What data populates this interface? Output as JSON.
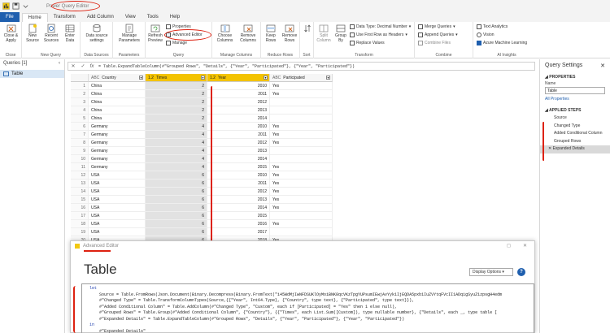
{
  "window": {
    "title": "Power Query Editor"
  },
  "tabs": [
    "File",
    "Home",
    "Transform",
    "Add Column",
    "View",
    "Tools",
    "Help"
  ],
  "ribbon": {
    "close": {
      "close_apply": "Close &\nApply",
      "group": "Close"
    },
    "new_query": {
      "new_source": "New\nSource",
      "recent_sources": "Recent\nSources",
      "enter_data": "Enter\nData",
      "group": "New Query"
    },
    "data_sources": {
      "settings": "Data source\nsettings",
      "group": "Data Sources"
    },
    "parameters": {
      "manage": "Manage\nParameters",
      "group": "Parameters"
    },
    "query": {
      "refresh": "Refresh\nPreview",
      "properties": "Properties",
      "advanced_editor": "Advanced Editor",
      "manage": "Manage",
      "group": "Query"
    },
    "manage_columns": {
      "choose": "Choose\nColumns",
      "remove": "Remove\nColumns",
      "group": "Manage Columns"
    },
    "reduce_rows": {
      "keep": "Keep\nRows",
      "remove": "Remove\nRows",
      "group": "Reduce Rows"
    },
    "sort": {
      "group": "Sort"
    },
    "transform": {
      "split": "Split\nColumn",
      "group_by": "Group\nBy",
      "data_type": "Data Type: Decimal Number",
      "first_row": "Use First Row as Headers",
      "replace": "Replace Values",
      "group": "Transform"
    },
    "combine": {
      "merge": "Merge Queries",
      "append": "Append Queries",
      "combine_files": "Combine Files",
      "group": "Combine"
    },
    "ai": {
      "text_analytics": "Text Analytics",
      "vision": "Vision",
      "azure_ml": "Azure Machine Learning",
      "group": "AI Insights"
    }
  },
  "queries_pane": {
    "header": "Queries [1]",
    "items": [
      "Table"
    ]
  },
  "formula_bar": {
    "fx": "fx",
    "text": "= Table.ExpandTableColumn(#\"Grouped Rows\", \"Details\", {\"Year\", \"Participated\"}, {\"Year\", \"Participated\"})"
  },
  "grid": {
    "columns": [
      {
        "type": "ABC",
        "name": "Country"
      },
      {
        "type": "1.2",
        "name": "Times"
      },
      {
        "type": "1.2",
        "name": "Year"
      },
      {
        "type": "ABC",
        "name": "Participated"
      }
    ],
    "rows": [
      [
        "1",
        "China",
        "2",
        "2010",
        "Yes"
      ],
      [
        "2",
        "China",
        "2",
        "2011",
        "Yes"
      ],
      [
        "3",
        "China",
        "2",
        "2012",
        ""
      ],
      [
        "4",
        "China",
        "2",
        "2013",
        ""
      ],
      [
        "5",
        "China",
        "2",
        "2014",
        ""
      ],
      [
        "6",
        "Germany",
        "4",
        "2010",
        "Yes"
      ],
      [
        "7",
        "Germany",
        "4",
        "2011",
        "Yes"
      ],
      [
        "8",
        "Germany",
        "4",
        "2012",
        "Yes"
      ],
      [
        "9",
        "Germany",
        "4",
        "2013",
        ""
      ],
      [
        "10",
        "Germany",
        "4",
        "2014",
        ""
      ],
      [
        "11",
        "Germany",
        "4",
        "2015",
        "Yes"
      ],
      [
        "12",
        "USA",
        "6",
        "2010",
        "Yes"
      ],
      [
        "13",
        "USA",
        "6",
        "2011",
        "Yes"
      ],
      [
        "14",
        "USA",
        "6",
        "2012",
        "Yes"
      ],
      [
        "15",
        "USA",
        "6",
        "2013",
        "Yes"
      ],
      [
        "16",
        "USA",
        "6",
        "2014",
        "Yes"
      ],
      [
        "17",
        "USA",
        "6",
        "2015",
        ""
      ],
      [
        "18",
        "USA",
        "6",
        "2016",
        "Yes"
      ],
      [
        "19",
        "USA",
        "6",
        "2017",
        ""
      ],
      [
        "20",
        "USA",
        "6",
        "2018",
        "Yes"
      ]
    ]
  },
  "query_settings": {
    "title": "Query Settings",
    "properties_label": "PROPERTIES",
    "name_label": "Name",
    "name_value": "Table",
    "all_properties": "All Properties",
    "applied_steps_label": "APPLIED STEPS",
    "steps": [
      "Source",
      "Changed Type",
      "Added Conditional Column",
      "Grouped Rows",
      "Expanded Details"
    ],
    "selected_step": 4
  },
  "advanced_editor": {
    "title": "Advanced Editor",
    "heading": "Table",
    "display_options": "Display Options",
    "help": "?",
    "code": [
      "let",
      "    Source = Table.FromRows(Json.Document(Binary.Decompress(Binary.FromText(\"i45WdMjIwNFDSUKlOyMoiBNK8qcVKzTpgYUPsumIEwjAvYyk1IjEQDA5pxb1IuZVYtqFVcII1ADqigSyuZ1zpsgH4edm",
      "    #\"Changed Type\" = Table.TransformColumnTypes(Source,{{\"Year\", Int64.Type}, {\"Country\", type text}, {\"Participated\", type text}}),",
      "    #\"Added Conditional Column\" = Table.AddColumn(#\"Changed Type\", \"Custom\", each if [Participated] = \"Yes\" then 1 else null),",
      "    #\"Grouped Rows\" = Table.Group(#\"Added Conditional Column\", {\"Country\"}, {{\"Times\", each List.Sum([Custom]), type nullable number}, {\"Details\", each _, type table [",
      "    #\"Expanded Details\" = Table.ExpandTableColumn(#\"Grouped Rows\", \"Details\", {\"Year\", \"Participated\"}, {\"Year\", \"Participated\"})",
      "in",
      "    #\"Expanded Details\""
    ]
  },
  "colors": {
    "file_tab": "#1f5fae",
    "selected_column": "#f3c300",
    "annotation_red": "#dd2211"
  }
}
